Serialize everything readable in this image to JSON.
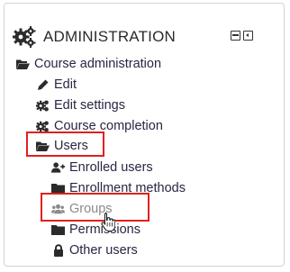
{
  "block": {
    "title": "ADMINISTRATION",
    "title_icon": "cogs-icon",
    "controls": [
      "minimize-icon",
      "dock-icon"
    ]
  },
  "tree": {
    "course_admin": {
      "label": "Course administration",
      "icon": "folder-open-icon"
    },
    "edit": {
      "label": "Edit",
      "icon": "pencil-icon"
    },
    "edit_settings": {
      "label": "Edit settings",
      "icon": "cogs-icon"
    },
    "course_completion": {
      "label": "Course completion",
      "icon": "cogs-icon"
    },
    "users": {
      "label": "Users",
      "icon": "folder-open-icon"
    },
    "enrolled_users": {
      "label": "Enrolled users",
      "icon": "user-plus-icon"
    },
    "enrollment_methods": {
      "label": "Enrollment methods",
      "icon": "folder-icon"
    },
    "groups": {
      "label": "Groups",
      "icon": "users-icon"
    },
    "permissions": {
      "label": "Permissions",
      "icon": "folder-icon"
    },
    "other_users": {
      "label": "Other users",
      "icon": "lock-icon"
    }
  },
  "colors": {
    "text": "#2a2542",
    "muted": "#8a8a8a",
    "highlight": "#e0201f",
    "icon": "#2b2b2b"
  }
}
